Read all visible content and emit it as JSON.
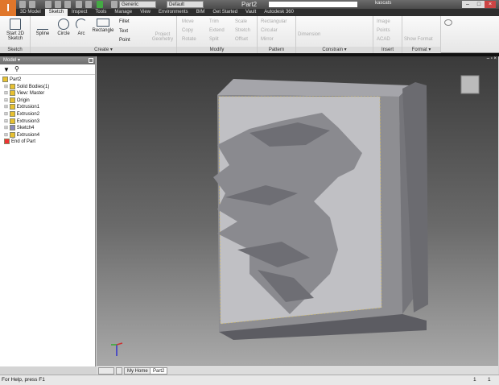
{
  "titlebar": {
    "app_logo": "I",
    "title": "Part2",
    "appearance": "Generic",
    "material": "Default",
    "user": "kascats",
    "search_placeholder": ""
  },
  "tabs": [
    "3D Model",
    "Sketch",
    "Inspect",
    "Tools",
    "Manage",
    "View",
    "Environments",
    "BIM",
    "Get Started",
    "Vault",
    "Autodesk 360"
  ],
  "active_tab": "Sketch",
  "ribbon": {
    "sketch": {
      "start": "Start 2D Sketch",
      "label": "Sketch"
    },
    "create": {
      "spline": "Spline",
      "circle": "Circle",
      "arc": "Arc",
      "rectangle": "Rectangle",
      "fillet": "Fillet",
      "text": "Text",
      "point": "Point",
      "label": "Create ▾"
    },
    "project_geometry": "Project Geometry",
    "modify": {
      "move": "Move",
      "copy": "Copy",
      "rotate": "Rotate",
      "trim": "Trim",
      "extend": "Extend",
      "split": "Split",
      "scale": "Scale",
      "stretch": "Stretch",
      "offset": "Offset",
      "label": "Modify"
    },
    "pattern": {
      "rectangular": "Rectangular",
      "circular": "Circular",
      "mirror": "Mirror",
      "label": "Pattern"
    },
    "constrain": {
      "dimension": "Dimension",
      "label": "Constrain ▾"
    },
    "insert": {
      "image": "Image",
      "points": "Points",
      "acad": "ACAD",
      "label": "Insert"
    },
    "format": {
      "show_format": "Show Format",
      "label": "Format ▾"
    }
  },
  "browser": {
    "title": "Model ▾",
    "items": [
      {
        "label": "Part2",
        "level": 0
      },
      {
        "label": "Solid Bodies(1)",
        "level": 1
      },
      {
        "label": "View: Master",
        "level": 1
      },
      {
        "label": "Origin",
        "level": 1
      },
      {
        "label": "Extrusion1",
        "level": 1
      },
      {
        "label": "Extrusion2",
        "level": 1
      },
      {
        "label": "Extrusion3",
        "level": 1
      },
      {
        "label": "Sketch4",
        "level": 1
      },
      {
        "label": "Extrusion4",
        "level": 1
      },
      {
        "label": "End of Part",
        "level": 1
      }
    ]
  },
  "doc_tabs": [
    "My Home",
    "Part2"
  ],
  "status": {
    "text": "For Help, press F1",
    "count1": "1",
    "count2": "1"
  },
  "colors": {
    "accent": "#e0762a",
    "ribbon_tab_bar": "#2e2e2e",
    "model": "#8e8e92"
  }
}
